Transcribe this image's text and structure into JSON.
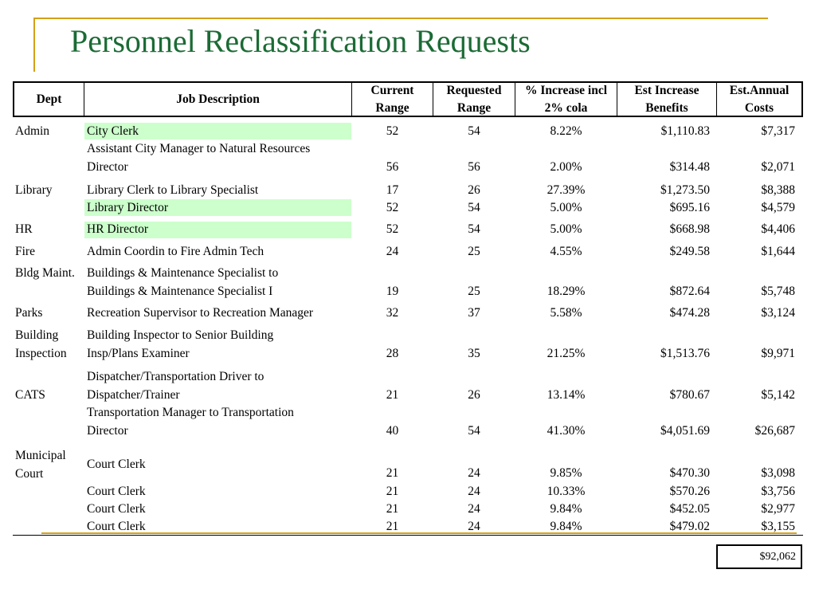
{
  "title": "Personnel Reclassification Requests",
  "headers": {
    "dept": "Dept",
    "job": "Job Description",
    "current": [
      "Current",
      "Range"
    ],
    "requested": [
      "Requested",
      "Range"
    ],
    "increase": [
      "% Increase incl",
      "2% cola"
    ],
    "benefits": [
      "Est Increase",
      "Benefits"
    ],
    "annual": [
      "Est.Annual",
      "Costs"
    ]
  },
  "depts": {
    "admin": "Admin",
    "library": "Library",
    "hr": "HR",
    "fire": "Fire",
    "bldg": "Bldg Maint.",
    "parks": "Parks",
    "bi1": "Building",
    "bi2": "Inspection",
    "cats": "CATS",
    "mc1": "Municipal",
    "mc2": "Court"
  },
  "jobs": {
    "r1": "City Clerk",
    "r2a": "Assistant City Manager to Natural Resources",
    "r2b": "Director",
    "r3": "Library Clerk to Library Specialist",
    "r4": "Library Director",
    "r5": "HR Director",
    "r6": "Admin Coordin to Fire Admin Tech",
    "r7a": "Buildings & Maintenance Specialist to",
    "r7b": "Buildings & Maintenance Specialist I",
    "r8": "Recreation Supervisor to Recreation Manager",
    "r9a": "Building Inspector to Senior Building",
    "r9b": "Insp/Plans Examiner",
    "r10a": "Dispatcher/Transportation Driver to",
    "r10b": "Dispatcher/Trainer",
    "r11a": "Transportation Manager to Transportation",
    "r11b": "Director",
    "r12": "Court Clerk",
    "r13": "Court Clerk",
    "r14": "Court Clerk",
    "r15": "Court Clerk"
  },
  "rows": [
    {
      "cur": "52",
      "req": "54",
      "pct": "8.22%",
      "ben": "$1,110.83",
      "cost": "$7,317"
    },
    {
      "cur": "56",
      "req": "56",
      "pct": "2.00%",
      "ben": "$314.48",
      "cost": "$2,071"
    },
    {
      "cur": "17",
      "req": "26",
      "pct": "27.39%",
      "ben": "$1,273.50",
      "cost": "$8,388"
    },
    {
      "cur": "52",
      "req": "54",
      "pct": "5.00%",
      "ben": "$695.16",
      "cost": "$4,579"
    },
    {
      "cur": "52",
      "req": "54",
      "pct": "5.00%",
      "ben": "$668.98",
      "cost": "$4,406"
    },
    {
      "cur": "24",
      "req": "25",
      "pct": "4.55%",
      "ben": "$249.58",
      "cost": "$1,644"
    },
    {
      "cur": "19",
      "req": "25",
      "pct": "18.29%",
      "ben": "$872.64",
      "cost": "$5,748"
    },
    {
      "cur": "32",
      "req": "37",
      "pct": "5.58%",
      "ben": "$474.28",
      "cost": "$3,124"
    },
    {
      "cur": "28",
      "req": "35",
      "pct": "21.25%",
      "ben": "$1,513.76",
      "cost": "$9,971"
    },
    {
      "cur": "21",
      "req": "26",
      "pct": "13.14%",
      "ben": "$780.67",
      "cost": "$5,142"
    },
    {
      "cur": "40",
      "req": "54",
      "pct": "41.30%",
      "ben": "$4,051.69",
      "cost": "$26,687"
    },
    {
      "cur": "21",
      "req": "24",
      "pct": "9.85%",
      "ben": "$470.30",
      "cost": "$3,098"
    },
    {
      "cur": "21",
      "req": "24",
      "pct": "10.33%",
      "ben": "$570.26",
      "cost": "$3,756"
    },
    {
      "cur": "21",
      "req": "24",
      "pct": "9.84%",
      "ben": "$452.05",
      "cost": "$2,977"
    },
    {
      "cur": "21",
      "req": "24",
      "pct": "9.84%",
      "ben": "$479.02",
      "cost": "$3,155"
    }
  ],
  "total": "$92,062",
  "colors": {
    "title": "#1b6b35",
    "accent": "#d4a017",
    "highlight": "#ccffcc"
  }
}
